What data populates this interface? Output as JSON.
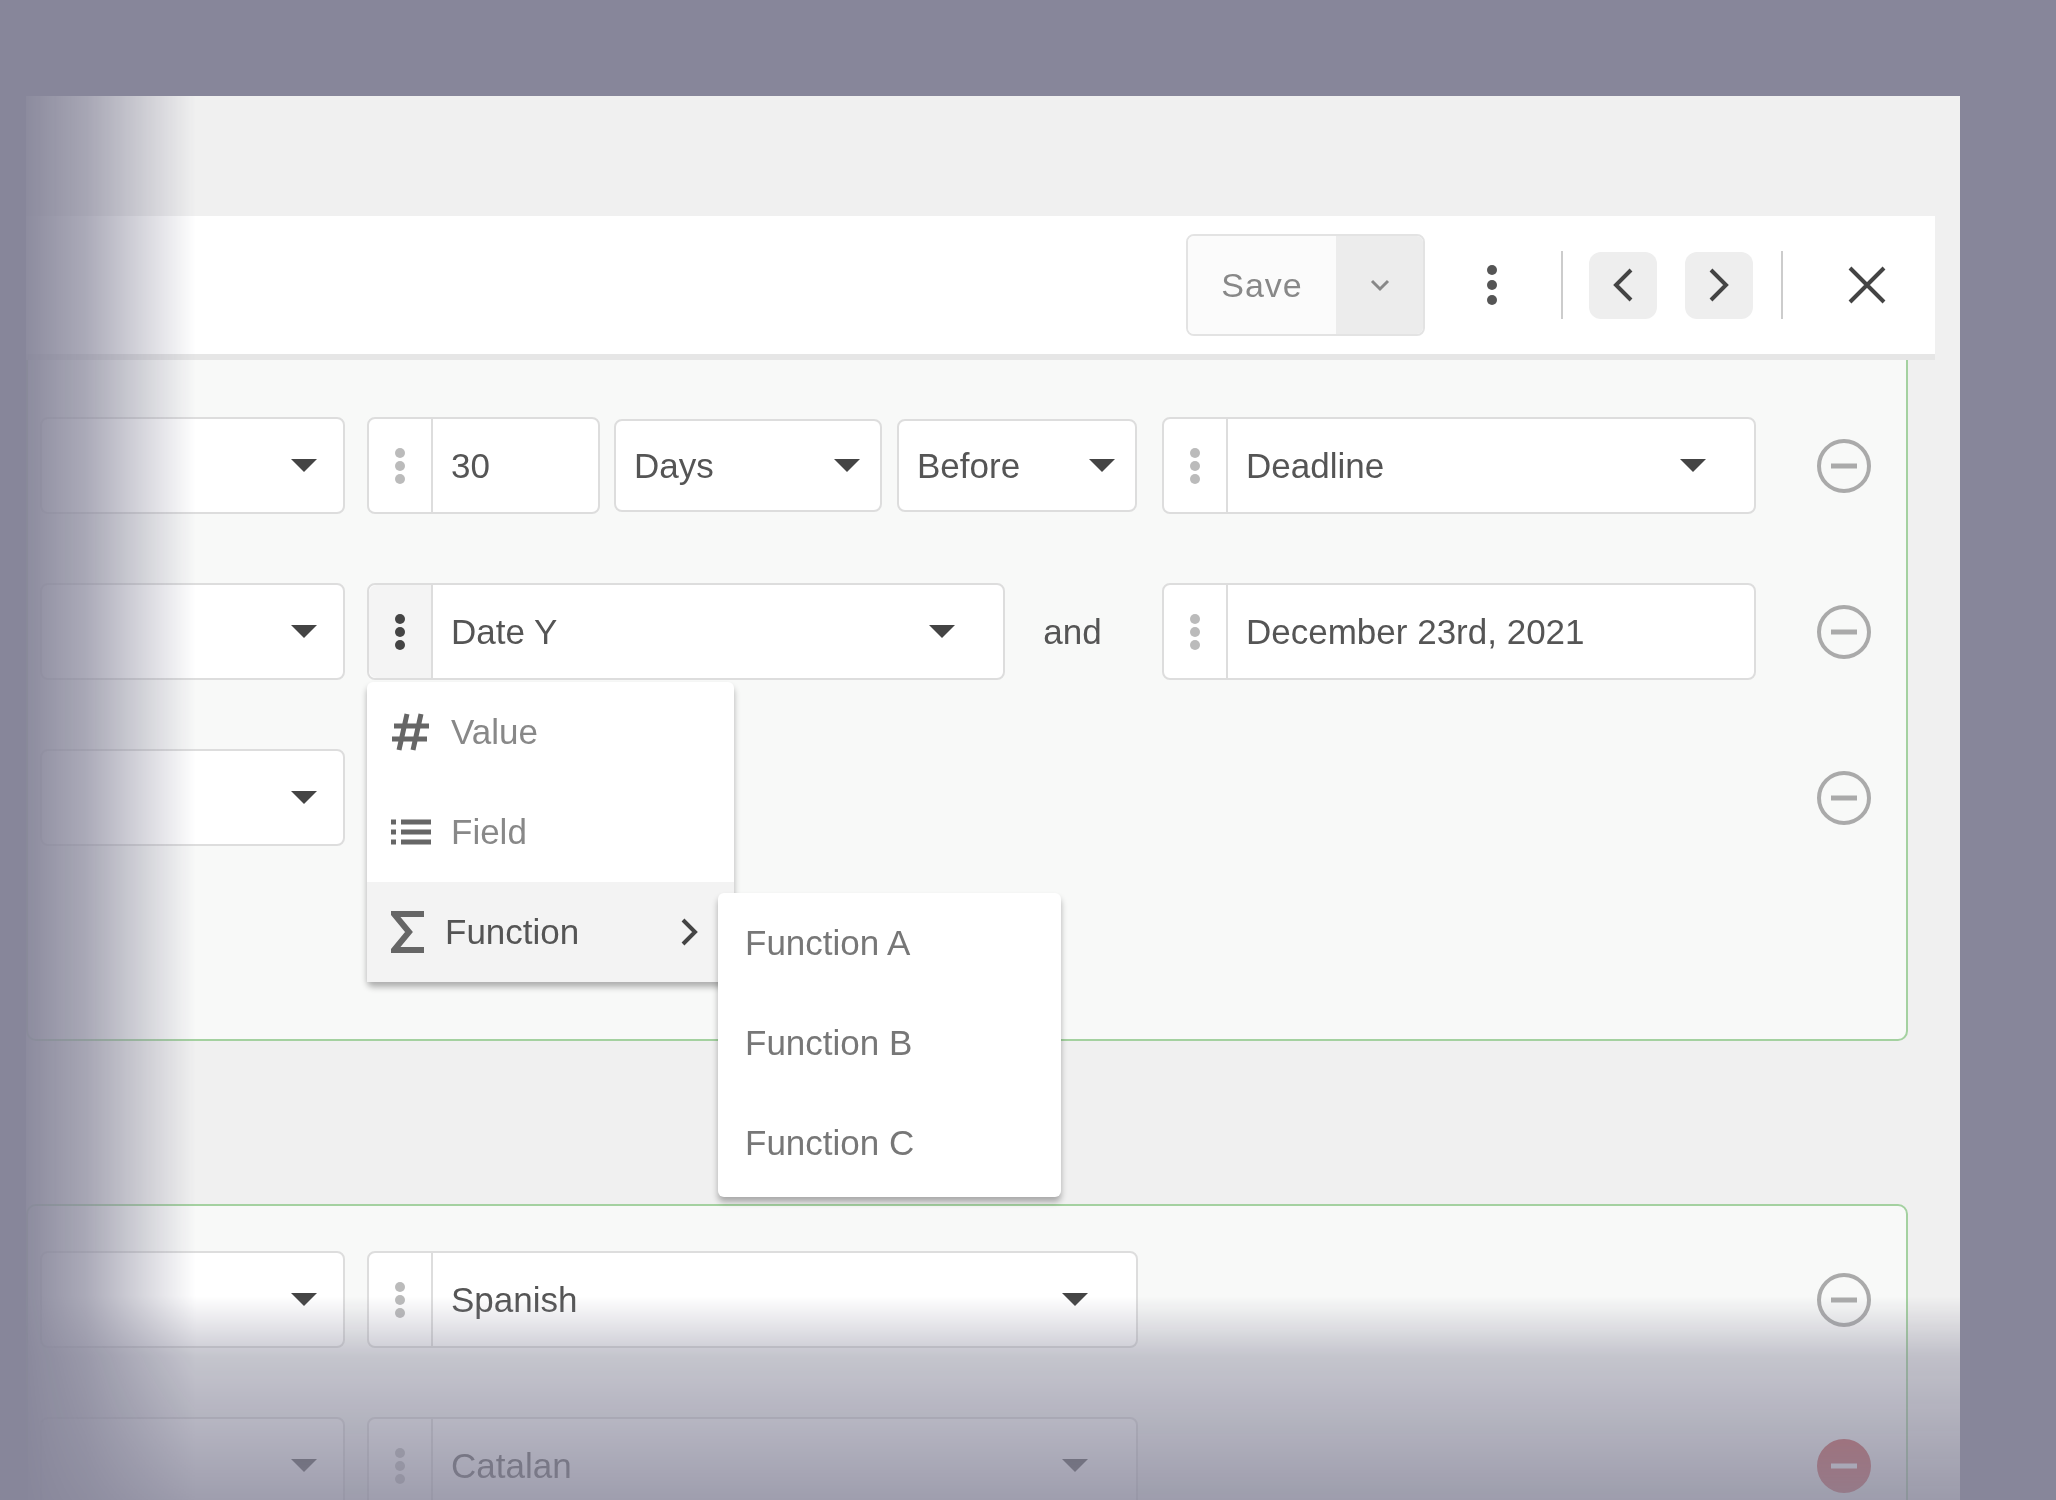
{
  "toolbar": {
    "save_button": "Save"
  },
  "groups": [
    {
      "rows": [
        {
          "kind": "relative",
          "handle_active": false,
          "amount": "30",
          "unit": "Days",
          "direction": "Before",
          "target": "Deadline",
          "danger": false
        },
        {
          "kind": "between",
          "handle_active": true,
          "operand": "Date Y",
          "connector": "and",
          "end_value": "December 23rd, 2021",
          "danger": false
        },
        {
          "kind": "empty",
          "danger": false
        }
      ]
    },
    {
      "rows": [
        {
          "kind": "single",
          "handle_active": false,
          "value": "Spanish",
          "danger": false
        },
        {
          "kind": "single",
          "handle_active": false,
          "value": "Catalan",
          "danger": true
        }
      ]
    }
  ],
  "menu": {
    "items": [
      {
        "kind": "value",
        "label": "Value",
        "selected": false,
        "submenu": false
      },
      {
        "kind": "field",
        "label": "Field",
        "selected": false,
        "submenu": false
      },
      {
        "kind": "function",
        "label": "Function",
        "selected": true,
        "submenu": true
      }
    ]
  },
  "submenu": {
    "items": [
      "Function A",
      "Function B",
      "Function C"
    ]
  }
}
